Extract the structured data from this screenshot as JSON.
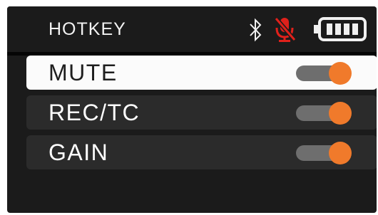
{
  "header": {
    "title": "HOTKEY",
    "icons": [
      "bluetooth-icon",
      "microphone-muted-icon",
      "battery-icon"
    ],
    "mic_color": "#e0211b",
    "battery_level": 1.0
  },
  "rows": [
    {
      "label": "MUTE",
      "enabled": true,
      "selected": true
    },
    {
      "label": "REC/TC",
      "enabled": true,
      "selected": false
    },
    {
      "label": "GAIN",
      "enabled": true,
      "selected": false
    }
  ],
  "colors": {
    "accent": "#f07a2b",
    "background": "#1b1b1b",
    "row_background": "#2b2b2b",
    "row_selected_background": "#fbfbfb",
    "toggle_track": "#6e6e6e"
  }
}
